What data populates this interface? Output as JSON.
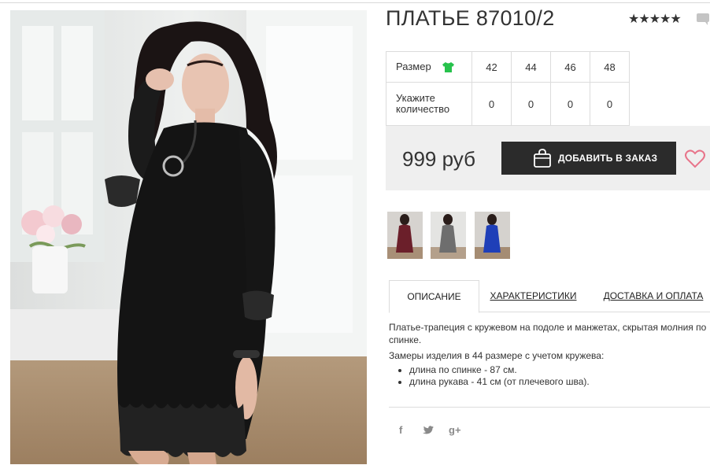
{
  "product": {
    "title": "ПЛАТЬЕ 87010/2",
    "rating_stars": "★★★★★",
    "rating_value": 4.5
  },
  "sizes": {
    "size_label": "Размер",
    "qty_label": "Укажите количество",
    "values": [
      "42",
      "44",
      "46",
      "48"
    ],
    "quantities": [
      "0",
      "0",
      "0",
      "0"
    ],
    "size_icon": "tshirt-icon",
    "size_icon_color": "#27c24c"
  },
  "order": {
    "price": "999 руб",
    "add_button": "ДОБАВИТЬ В ЗАКАЗ",
    "button_icon": "shopping-bag-icon",
    "favorite_icon": "heart-icon",
    "heart_color": "#e8748a"
  },
  "thumbnails": [
    {
      "name": "burgundy",
      "color": "#6b1f2a"
    },
    {
      "name": "grey",
      "color": "#6e6e6e"
    },
    {
      "name": "blue",
      "color": "#1f3fb8"
    }
  ],
  "tabs": [
    "ОПИСАНИЕ",
    "ХАРАКТЕРИСТИКИ",
    "ДОСТАВКА И ОПЛАТА"
  ],
  "description": {
    "intro": "Платье-трапеция с кружевом на подоле и манжетах, скрытая молния по спинке.",
    "measures_title": "Замеры изделия в 44 размере с учетом кружева:",
    "items": [
      "длина по спинке - 87 см.",
      "длина рукава - 41 см (от плечевого шва)."
    ]
  },
  "social": {
    "facebook": "f",
    "twitter_icon": "twitter-icon",
    "googleplus": "g+"
  }
}
